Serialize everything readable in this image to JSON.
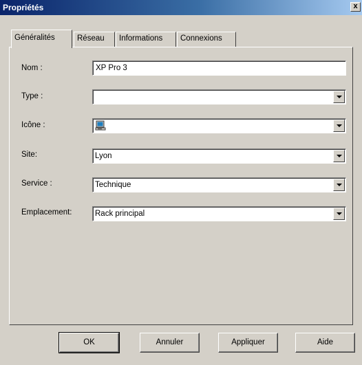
{
  "window": {
    "title": "Propriétés",
    "close_label": "x"
  },
  "tabs": [
    {
      "label": "Généralités",
      "active": true
    },
    {
      "label": "Réseau",
      "active": false
    },
    {
      "label": "Informations",
      "active": false
    },
    {
      "label": "Connexions",
      "active": false
    }
  ],
  "form": {
    "nom": {
      "label": "Nom :",
      "value": "XP Pro 3"
    },
    "type": {
      "label": "Type :",
      "value": ""
    },
    "icone": {
      "label": "Icône :",
      "icon": "computer-icon"
    },
    "site": {
      "label": "Site:",
      "value": "Lyon"
    },
    "service": {
      "label": "Service :",
      "value": "Technique"
    },
    "emplacement": {
      "label": "Emplacement:",
      "value": "Rack principal"
    }
  },
  "buttons": {
    "ok": "OK",
    "annuler": "Annuler",
    "appliquer": "Appliquer",
    "aide": "Aide"
  }
}
